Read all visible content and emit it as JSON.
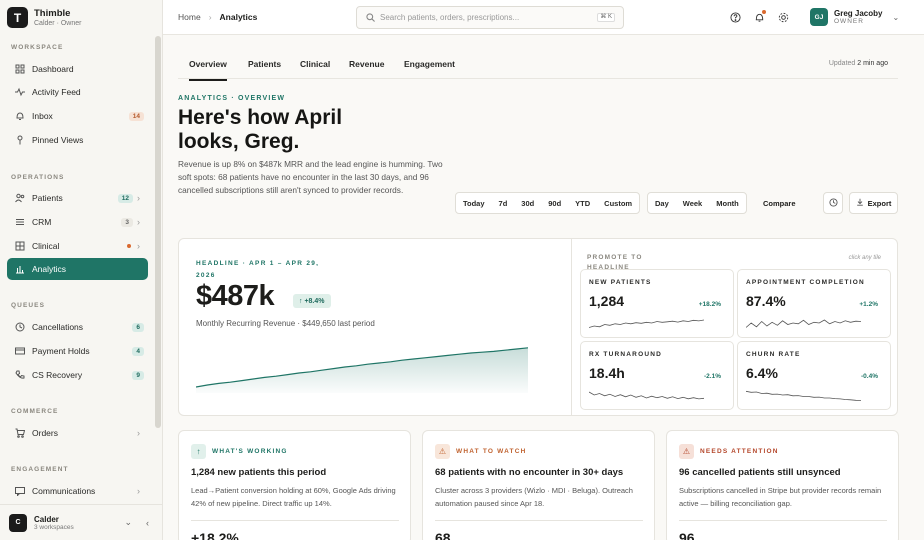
{
  "brand": {
    "logo": "T",
    "name": "Thimble",
    "sub": "Calder · Owner"
  },
  "sidebar": {
    "sections": {
      "workspace": "WORKSPACE",
      "operations": "OPERATIONS",
      "queues": "QUEUES",
      "commerce": "COMMERCE",
      "engagement": "ENGAGEMENT"
    },
    "items": [
      {
        "label": "Dashboard",
        "icon": "grid-icon"
      },
      {
        "label": "Activity Feed",
        "icon": "activity-icon"
      },
      {
        "label": "Inbox",
        "icon": "bell-icon",
        "badge": "14"
      },
      {
        "label": "Pinned Views",
        "icon": "pin-icon"
      },
      {
        "label": "Patients",
        "icon": "users-icon",
        "badge": "12"
      },
      {
        "label": "CRM",
        "icon": "list-icon",
        "badge": "3"
      },
      {
        "label": "Clinical",
        "icon": "clinical-icon"
      },
      {
        "label": "Analytics",
        "icon": "bar-chart-icon"
      },
      {
        "label": "Cancellations",
        "icon": "clock-icon",
        "badge": "6"
      },
      {
        "label": "Payment Holds",
        "icon": "card-icon",
        "badge": "4"
      },
      {
        "label": "CS Recovery",
        "icon": "phone-icon",
        "badge": "9"
      },
      {
        "label": "Orders",
        "icon": "cart-icon"
      },
      {
        "label": "Communications",
        "icon": "message-icon"
      }
    ]
  },
  "workspace_switcher": {
    "avatar": "C",
    "name": "Calder",
    "sub": "3 workspaces"
  },
  "topbar": {
    "breadcrumb": {
      "home": "Home",
      "current": "Analytics"
    },
    "search_placeholder": "Search patients, orders, prescriptions...",
    "shortcut": "⌘ K",
    "user": {
      "initials": "GJ",
      "name": "Greg Jacoby",
      "role": "OWNER"
    }
  },
  "tabs": [
    "Overview",
    "Patients",
    "Clinical",
    "Revenue",
    "Engagement"
  ],
  "updated": {
    "label": "Updated",
    "value": "2 min ago"
  },
  "hero": {
    "eyebrow": "ANALYTICS · OVERVIEW",
    "title": "Here's how April looks, Greg.",
    "desc": "Revenue is up 8% on $487k MRR and the lead engine is humming. Two soft spots: 68 patients have no encounter in the last 30 days, and 96 cancelled subscriptions still aren't synced to provider records."
  },
  "toolbar": {
    "ranges": [
      "Today",
      "7d",
      "30d",
      "90d",
      "YTD",
      "Custom"
    ],
    "granularity": [
      "Day",
      "Week",
      "Month"
    ],
    "compare": "Compare",
    "export": "Export"
  },
  "headline": {
    "eyebrow": "HEADLINE · APR 1 – APR 29, 2026",
    "value": "$487k",
    "delta": "+8.4%",
    "sub": "Monthly Recurring Revenue · $449,650 last period",
    "promote": "PROMOTE TO HEADLINE",
    "hint": "click any tile"
  },
  "chart_data": {
    "type": "area",
    "title": "",
    "values": [
      0.0,
      0.05,
      0.09,
      0.12,
      0.16,
      0.2,
      0.24,
      0.27,
      0.31,
      0.35,
      0.38,
      0.42,
      0.46,
      0.5,
      0.53,
      0.57,
      0.6,
      0.63,
      0.67,
      0.7,
      0.73,
      0.76,
      0.79,
      0.82,
      0.85,
      0.87,
      0.89,
      0.92,
      0.95,
      0.98
    ]
  },
  "tiles": [
    {
      "label": "NEW PATIENTS",
      "value": "1,284",
      "delta": "+18.2%",
      "trend": "up",
      "spark": [
        0.3,
        0.4,
        0.35,
        0.5,
        0.45,
        0.55,
        0.5,
        0.6,
        0.55,
        0.62,
        0.58,
        0.65,
        0.6,
        0.7,
        0.65,
        0.68,
        0.72,
        0.66,
        0.75,
        0.7,
        0.78,
        0.74,
        0.8
      ]
    },
    {
      "label": "APPOINTMENT COMPLETION",
      "value": "87.4%",
      "delta": "+1.2%",
      "trend": "up",
      "spark": [
        0.3,
        0.6,
        0.35,
        0.7,
        0.4,
        0.65,
        0.45,
        0.75,
        0.5,
        0.6,
        0.55,
        0.78,
        0.5,
        0.65,
        0.6,
        0.8,
        0.55,
        0.7,
        0.6,
        0.75,
        0.65,
        0.72,
        0.7
      ]
    },
    {
      "label": "RX TURNAROUND",
      "value": "18.4h",
      "delta": "-2.1%",
      "trend": "down",
      "spark": [
        0.8,
        0.6,
        0.7,
        0.55,
        0.65,
        0.5,
        0.62,
        0.48,
        0.6,
        0.45,
        0.55,
        0.4,
        0.52,
        0.42,
        0.5,
        0.38,
        0.48,
        0.36,
        0.45,
        0.35,
        0.42,
        0.34,
        0.38
      ]
    },
    {
      "label": "CHURN RATE",
      "value": "6.4%",
      "delta": "-0.4%",
      "trend": "down",
      "spark": [
        0.85,
        0.78,
        0.8,
        0.7,
        0.72,
        0.65,
        0.66,
        0.6,
        0.62,
        0.55,
        0.56,
        0.5,
        0.5,
        0.45,
        0.46,
        0.4,
        0.4,
        0.36,
        0.34,
        0.3,
        0.28,
        0.25,
        0.24
      ]
    }
  ],
  "insights": [
    {
      "tag": "WHAT'S WORKING",
      "icon": "↑",
      "title": "1,284 new patients this period",
      "body": "Lead→Patient conversion holding at 60%, Google Ads driving 42% of new pipeline. Direct traffic up 14%.",
      "num": "+18.2%",
      "accent": "#1f7566",
      "bg": "#e1f0eb"
    },
    {
      "tag": "WHAT TO WATCH",
      "icon": "⚠",
      "title": "68 patients with no encounter in 30+ days",
      "body": "Cluster across 3 providers (Wizlo · MDI · Beluga). Outreach automation paused since Apr 18.",
      "num": "68",
      "accent": "#c0622f",
      "bg": "#f8e6da"
    },
    {
      "tag": "NEEDS ATTENTION",
      "icon": "⚠",
      "title": "96 cancelled patients still unsynced",
      "body": "Subscriptions cancelled in Stripe but provider records remain active — billing reconciliation gap.",
      "num": "96",
      "accent": "#b4462a",
      "bg": "#f6e0d8"
    }
  ],
  "colors": {
    "accent": "#1f7566",
    "warn": "#c0622f",
    "danger": "#b4462a"
  }
}
